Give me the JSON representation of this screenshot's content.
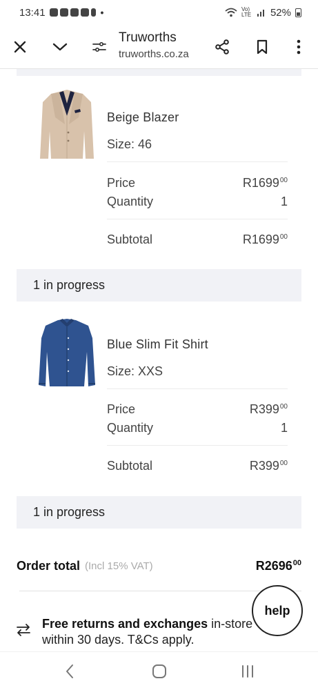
{
  "status_bar": {
    "time": "13:41",
    "network": "Vo) LTE",
    "battery": "52%"
  },
  "browser": {
    "site_name": "Truworths",
    "url": "truworths.co.za",
    "icons": [
      "close-icon",
      "chevron-down-icon",
      "site-settings-icon",
      "share-icon",
      "bookmark-icon",
      "more-vert-icon"
    ]
  },
  "items": [
    {
      "name": "Beige Blazer",
      "size": "Size: 46",
      "price_label": "Price",
      "price": "R1699",
      "price_cents": "00",
      "quantity_label": "Quantity",
      "quantity": "1",
      "subtotal_label": "Subtotal",
      "subtotal": "R1699",
      "subtotal_cents": "00",
      "status": "1 in progress",
      "image_color": "#d9c3ad"
    },
    {
      "name": "Blue Slim Fit Shirt",
      "size": "Size: XXS",
      "price_label": "Price",
      "price": "R399",
      "price_cents": "00",
      "quantity_label": "Quantity",
      "quantity": "1",
      "subtotal_label": "Subtotal",
      "subtotal": "R399",
      "subtotal_cents": "00",
      "status": "1 in progress",
      "image_color": "#2f5390"
    }
  ],
  "order_total": {
    "label": "Order total",
    "vat_note": "(Incl 15% VAT)",
    "value": "R2696",
    "cents": "00"
  },
  "returns": {
    "bold": "Free returns and exchanges",
    "rest": " in-store within 30 days. T&Cs apply."
  },
  "help_button": {
    "label": "help"
  }
}
